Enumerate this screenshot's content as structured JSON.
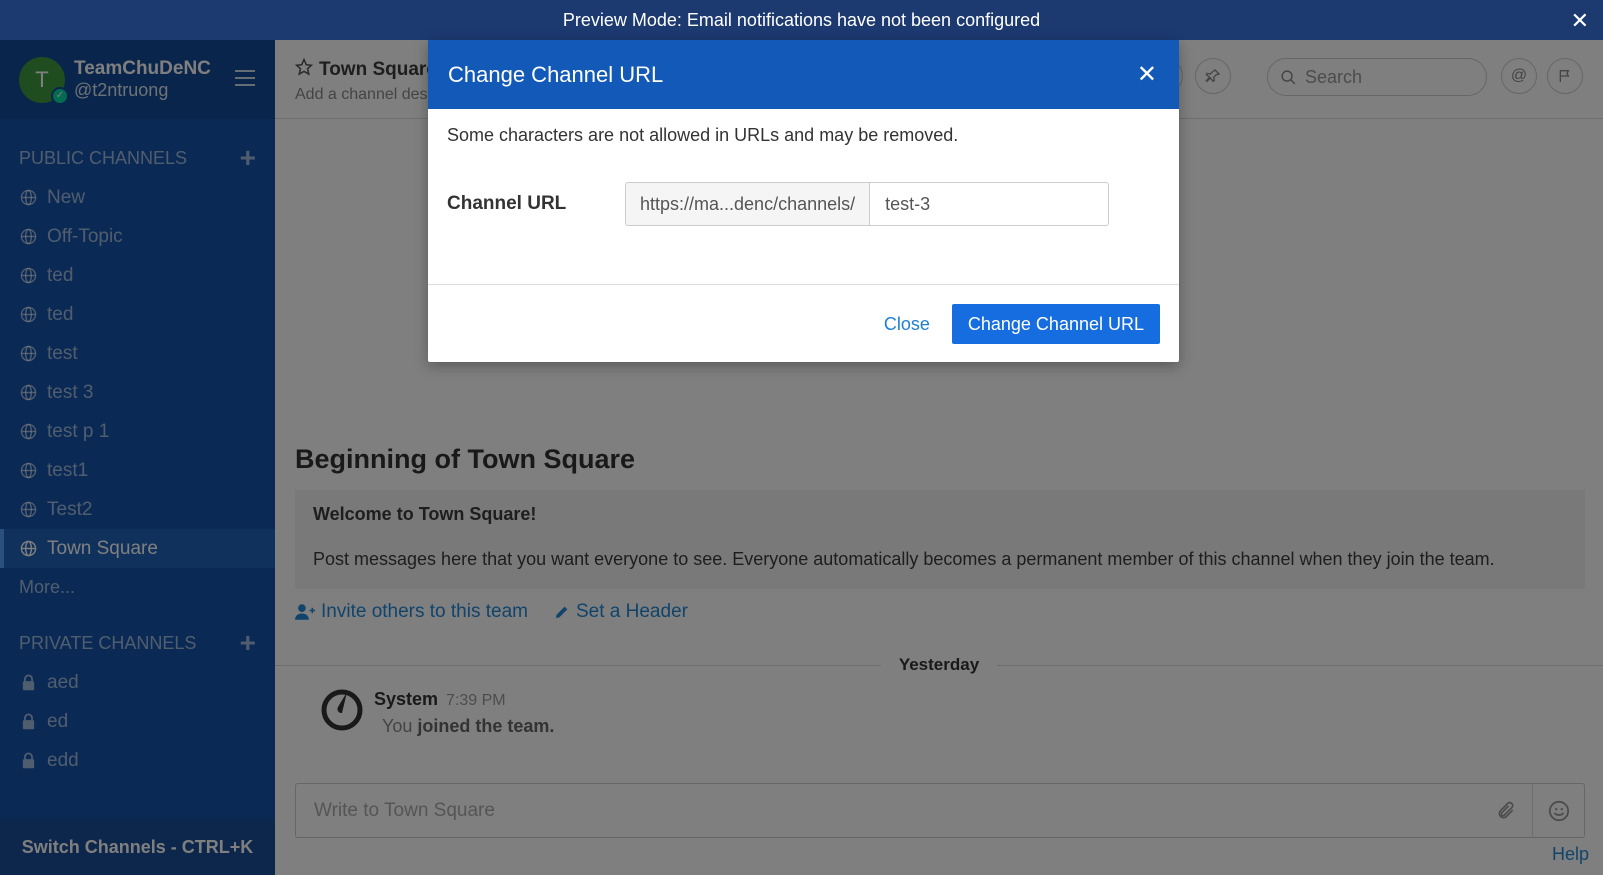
{
  "announcement": {
    "text": "Preview Mode: Email notifications have not been configured",
    "close": "✕"
  },
  "sidebar": {
    "team_initial": "T",
    "team_name": "TeamChuDeNC",
    "username": "@t2ntruong",
    "public_title": "PUBLIC CHANNELS",
    "public_channels": [
      "New",
      "Off-Topic",
      "ted",
      "ted",
      "test",
      "test 3",
      "test p 1",
      "test1",
      "Test2",
      "Town Square"
    ],
    "active_channel": "Town Square",
    "more": "More...",
    "private_title": "PRIVATE CHANNELS",
    "private_channels": [
      "aed",
      "ed",
      "edd"
    ],
    "switch": "Switch Channels - CTRL+K"
  },
  "header": {
    "channel_name": "Town Square",
    "channel_desc": "Add a channel desc",
    "search_placeholder": "Search"
  },
  "center": {
    "beginning": "Beginning of Town Square",
    "welcome_title": "Welcome to Town Square!",
    "welcome_text": "Post messages here that you want everyone to see. Everyone automatically becomes a permanent member of this channel when they join the team.",
    "invite_link": "Invite others to this team",
    "header_link": "Set a Header",
    "date_separator": "Yesterday",
    "post": {
      "user": "System",
      "time": "7:39 PM",
      "prefix": "You",
      "bold": "joined the team."
    },
    "composer_placeholder": "Write to Town Square",
    "help": "Help"
  },
  "modal": {
    "title": "Change Channel URL",
    "help_text": "Some characters are not allowed in URLs and may be removed.",
    "url_label": "Channel URL",
    "url_prefix": "https://ma...denc/channels/",
    "url_value": "test-3",
    "close_label": "Close",
    "submit_label": "Change Channel URL"
  },
  "colors": {
    "sidebar": "#1453a8",
    "modal_header": "#1359b8",
    "primary": "#166de0",
    "link": "#2389d7"
  }
}
